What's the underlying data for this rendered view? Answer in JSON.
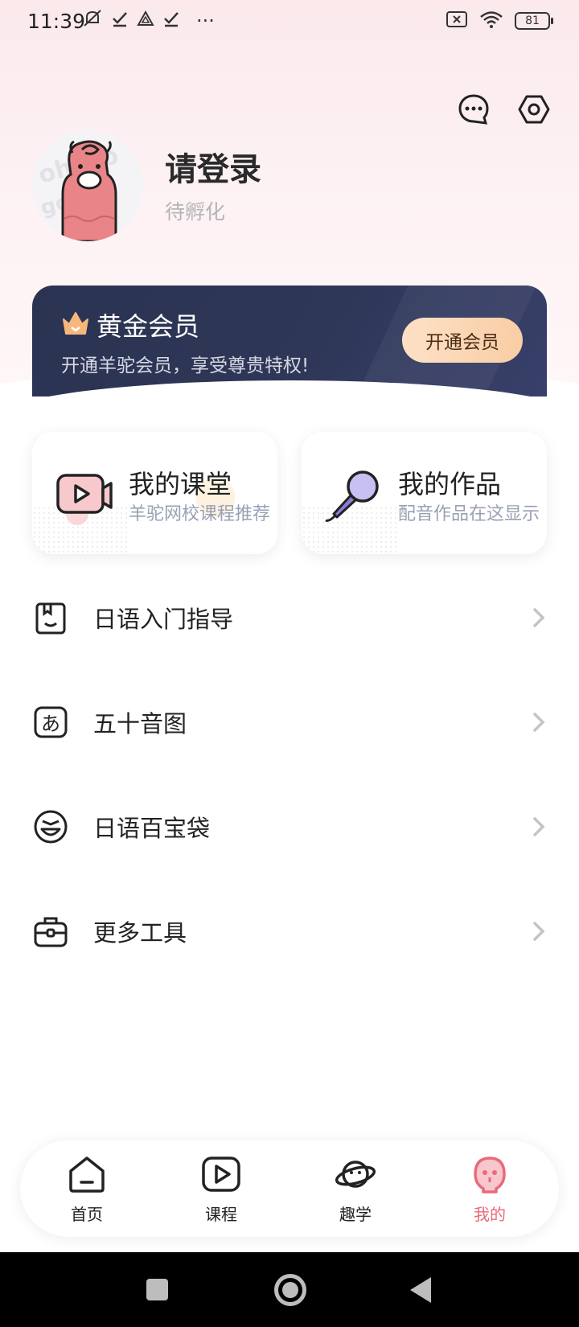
{
  "status_bar": {
    "time": "11:39",
    "more": "···",
    "battery": "81"
  },
  "profile": {
    "title": "请登录",
    "subtitle": "待孵化"
  },
  "vip": {
    "title": "黄金会员",
    "desc": "开通羊驼会员，享受尊贵特权!",
    "button": "开通会员"
  },
  "features": [
    {
      "title": "我的课堂",
      "subtitle": "羊驼网校课程推荐",
      "icon": "video-camera-icon"
    },
    {
      "title": "我的作品",
      "subtitle": "配音作品在这显示",
      "icon": "microphone-icon"
    }
  ],
  "menu": [
    {
      "label": "日语入门指导",
      "icon": "book-icon"
    },
    {
      "label": "五十音图",
      "icon": "hiragana-icon"
    },
    {
      "label": "日语百宝袋",
      "icon": "face-bag-icon"
    },
    {
      "label": "更多工具",
      "icon": "toolbox-icon"
    }
  ],
  "bottom_nav": [
    {
      "label": "首页",
      "icon": "home-icon",
      "active": false
    },
    {
      "label": "课程",
      "icon": "play-icon",
      "active": false
    },
    {
      "label": "趣学",
      "icon": "planet-icon",
      "active": false
    },
    {
      "label": "我的",
      "icon": "mascot-icon",
      "active": true
    }
  ],
  "colors": {
    "accent": "#e96a7a",
    "vip_bg": "#2b3352",
    "vip_button": "#f9cda5"
  }
}
